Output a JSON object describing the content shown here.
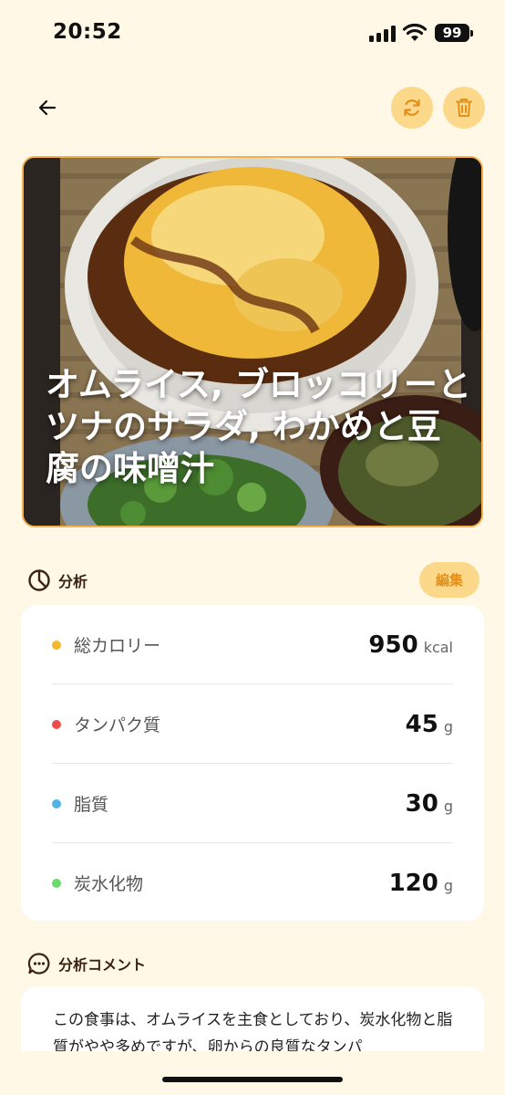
{
  "status_bar": {
    "time": "20:52",
    "battery": "99"
  },
  "header": {
    "back_icon": "arrow-left-icon",
    "refresh_icon": "refresh-icon",
    "delete_icon": "trash-icon",
    "accent_color": "#FCD98A"
  },
  "meal": {
    "title": "オムライス, ブロッコリーとツナのサラダ, わかめと豆腐の味噌汁"
  },
  "analysis": {
    "section_title": "分析",
    "section_icon": "pie-chart-icon",
    "edit_label": "編集",
    "items": [
      {
        "label": "総カロリー",
        "value": "950",
        "unit": "kcal",
        "color": "#F5B52E"
      },
      {
        "label": "タンパク質",
        "value": "45",
        "unit": "g",
        "color": "#EE4B4B"
      },
      {
        "label": "脂質",
        "value": "30",
        "unit": "g",
        "color": "#4FB3E8"
      },
      {
        "label": "炭水化物",
        "value": "120",
        "unit": "g",
        "color": "#6BDB6B"
      }
    ]
  },
  "comment": {
    "section_title": "分析コメント",
    "section_icon": "chat-bubble-icon",
    "text": "この食事は、オムライスを主食としており、炭水化物と脂質がやや多めですが、卵からの良質なタンパ"
  }
}
